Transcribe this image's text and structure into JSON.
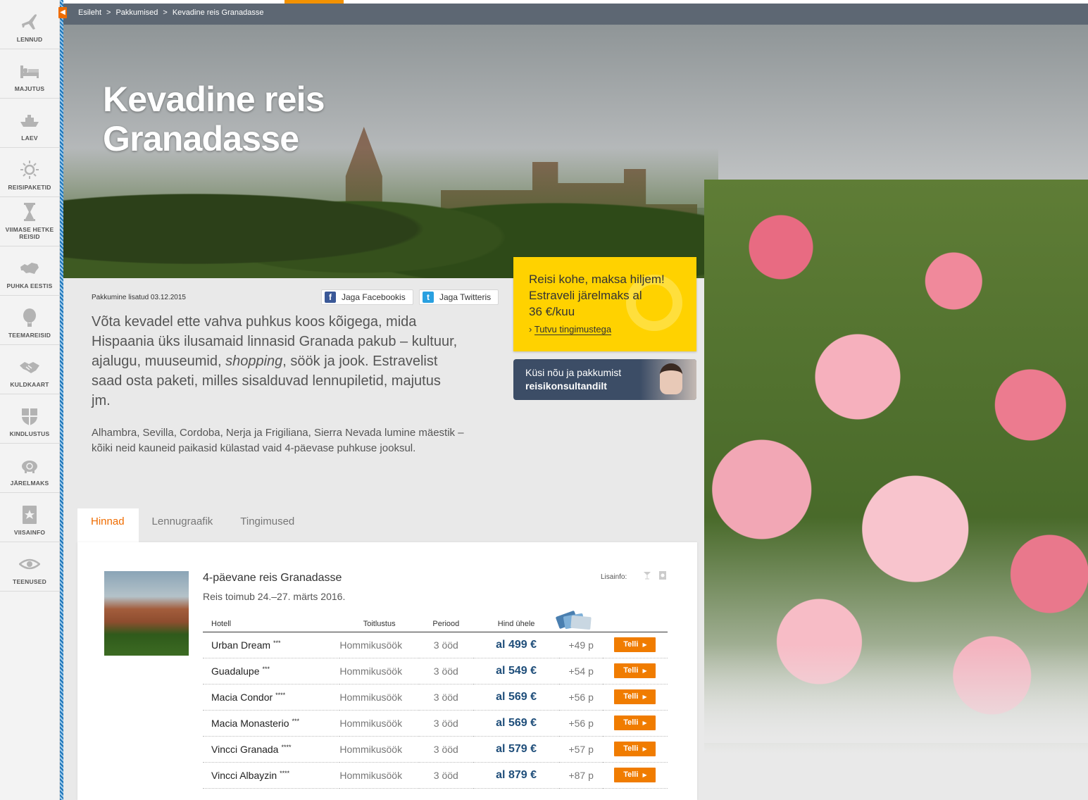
{
  "sidebar": {
    "items": [
      {
        "label": "LENNUD",
        "icon": "plane-icon"
      },
      {
        "label": "MAJUTUS",
        "icon": "bed-icon"
      },
      {
        "label": "LAEV",
        "icon": "ship-icon"
      },
      {
        "label": "REISIPAKETID",
        "icon": "sun-icon"
      },
      {
        "label": "VIIMASE HETKE REISID",
        "icon": "hourglass-icon"
      },
      {
        "label": "PUHKA EESTIS",
        "icon": "estonia-map-icon"
      },
      {
        "label": "TEEMAREISID",
        "icon": "balloon-icon"
      },
      {
        "label": "KULDKAART",
        "icon": "handshake-icon"
      },
      {
        "label": "KINDLUSTUS",
        "icon": "shield-icon"
      },
      {
        "label": "JÄRELMAKS",
        "icon": "piggybank-icon"
      },
      {
        "label": "VIISAINFO",
        "icon": "passport-icon"
      },
      {
        "label": "TEENUSED",
        "icon": "eye-icon"
      }
    ]
  },
  "breadcrumb": {
    "items": [
      "Esileht",
      "Pakkumised",
      "Kevadine reis Granadasse"
    ],
    "separator": ">"
  },
  "hero": {
    "title_line1": "Kevadine reis",
    "title_line2": "Granadasse"
  },
  "offer": {
    "added_date": "Pakkumine lisatud 03.12.2015",
    "share_facebook": "Jaga Facebookis",
    "share_twitter": "Jaga Twitteris",
    "lead_part1": "Võta kevadel ette vahva puhkus koos kõigega, mida Hispaania üks ilusamaid linnasid Granada pakub – kultuur, ajalugu, muuseumid, ",
    "lead_em": "shopping",
    "lead_part2": ", söök ja jook. Estravelist saad osta paketi, milles sisalduvad lennupiletid, majutus jm.",
    "sub": "Alhambra, Sevilla, Cordoba, Nerja ja Frigiliana, Sierra Nevada lumine mäestik – kõiki neid kauneid paikasid külastad vaid 4-päevase puhkuse jooksul."
  },
  "promo": {
    "text_line1": "Reisi kohe, maksa hiljem!",
    "text_line2": "Estraveli järelmaks al",
    "text_line3": "36 €/kuu",
    "link": "Tutvu tingimustega",
    "consult_line1": "Küsi nõu ja pakkumist",
    "consult_line2": "reisikonsultandilt"
  },
  "tabs": [
    {
      "label": "Hinnad",
      "active": true
    },
    {
      "label": "Lennugraafik",
      "active": false
    },
    {
      "label": "Tingimused",
      "active": false
    }
  ],
  "trip": {
    "title": "4-päevane reis Granadasse",
    "date_text": "Reis toimub 24.–27. märts 2016.",
    "lisainfo": "Lisainfo:"
  },
  "table": {
    "headers": [
      "Hotell",
      "Toitlustus",
      "Periood",
      "Hind ühele"
    ],
    "order_label": "Telli",
    "rows": [
      {
        "hotel": "Urban Dream",
        "stars": "***",
        "food": "Hommikusöök",
        "period": "3 ööd",
        "price": "al 499 €",
        "plus": "+49 p"
      },
      {
        "hotel": "Guadalupe",
        "stars": "***",
        "food": "Hommikusöök",
        "period": "3 ööd",
        "price": "al 549 €",
        "plus": "+54 p"
      },
      {
        "hotel": "Macia Condor",
        "stars": "****",
        "food": "Hommikusöök",
        "period": "3 ööd",
        "price": "al 569 €",
        "plus": "+56 p"
      },
      {
        "hotel": "Macia Monasterio",
        "stars": "***",
        "food": "Hommikusöök",
        "period": "3 ööd",
        "price": "al 569 €",
        "plus": "+56 p"
      },
      {
        "hotel": "Vincci Granada",
        "stars": "****",
        "food": "Hommikusöök",
        "period": "3 ööd",
        "price": "al 579 €",
        "plus": "+57 p"
      },
      {
        "hotel": "Vincci Albayzin",
        "stars": "****",
        "food": "Hommikusöök",
        "period": "3 ööd",
        "price": "al 879 €",
        "plus": "+87 p"
      }
    ]
  },
  "colors": {
    "accent": "#ef6c00",
    "topbar": "#5d6773",
    "promo": "#ffd200",
    "price": "#1f4e7a",
    "consult": "#3c4d66"
  }
}
